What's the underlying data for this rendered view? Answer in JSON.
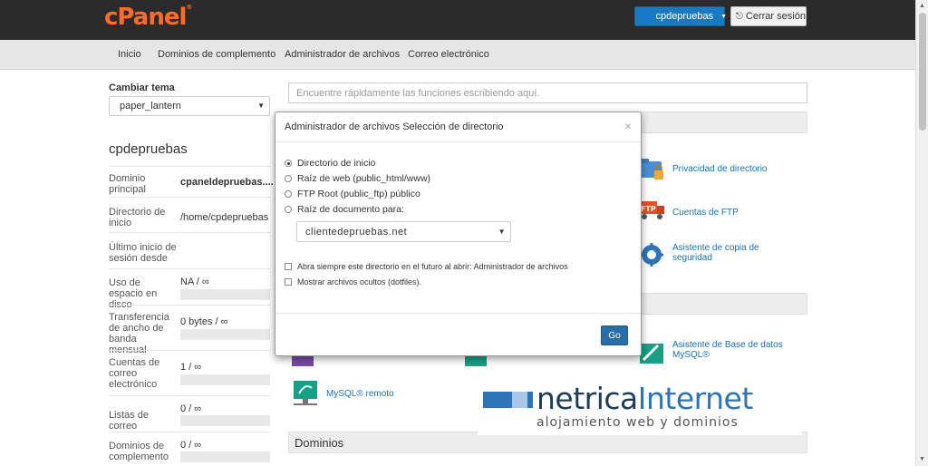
{
  "header": {
    "logo": "cPanel",
    "user_button": "cpdepruebas",
    "logout_button": "Cerrar sesión"
  },
  "nav": {
    "items": [
      "Inicio",
      "Dominios de complemento",
      "Administrador de archivos",
      "Correo electrónico"
    ]
  },
  "sidebar": {
    "theme_label": "Cambiar tema",
    "theme_value": "paper_lantern",
    "account_name": "cpdepruebas",
    "stats": [
      {
        "label": "Dominio principal",
        "value": "cpaneldepruebas...."
      },
      {
        "label": "Directorio de inicio",
        "value": "/home/cpdepruebas"
      },
      {
        "label": "Último inicio de sesión desde",
        "value": ""
      },
      {
        "label": "Uso de espacio en disco",
        "value": "NA / ∞"
      },
      {
        "label": "Transferencia de ancho de banda mensual",
        "value": "0 bytes / ∞"
      },
      {
        "label": "Cuentas de correo electrónico",
        "value": "1 / ∞"
      },
      {
        "label": "Listas de correo",
        "value": "0 / ∞"
      },
      {
        "label": "Dominios de complemento",
        "value": "0 / ∞"
      }
    ]
  },
  "main": {
    "search_placeholder": "Encuentre rápidamente las funciones escribiendo aquí.",
    "tools": {
      "privacy": "Privacidad de directorio",
      "ftp": "Cuentas de FTP",
      "backup": "Asistente de copia de seguridad",
      "mysql_wizard": "Asistente de Base de datos MySQL®",
      "remote_mysql": "MySQL® remoto"
    },
    "domains_section": "Dominios"
  },
  "watermark": {
    "brand_a": "netrica",
    "brand_b": "Internet",
    "tagline": "alojamiento web y dominios"
  },
  "modal": {
    "title": "Administrador de archivos  Selección de directorio",
    "close": "×",
    "options": [
      {
        "label": "Directorio de inicio",
        "selected": true
      },
      {
        "label": "Raíz de web (public_html/www)",
        "selected": false
      },
      {
        "label": "FTP Root (public_ftp) público",
        "selected": false
      },
      {
        "label": "Raíz de documento para:",
        "selected": false
      }
    ],
    "domain_select": "clientedepruebas.net",
    "checkboxes": [
      "Abra siempre este directorio en el futuro al abrir: Administrador de archivos",
      "Mostrar archivos ocultos (dotfiles)."
    ],
    "go_button": "Go"
  },
  "colors": {
    "accent": "#1a7ac0",
    "logo": "#ff6c2c",
    "topbar": "#2b2b2b"
  }
}
